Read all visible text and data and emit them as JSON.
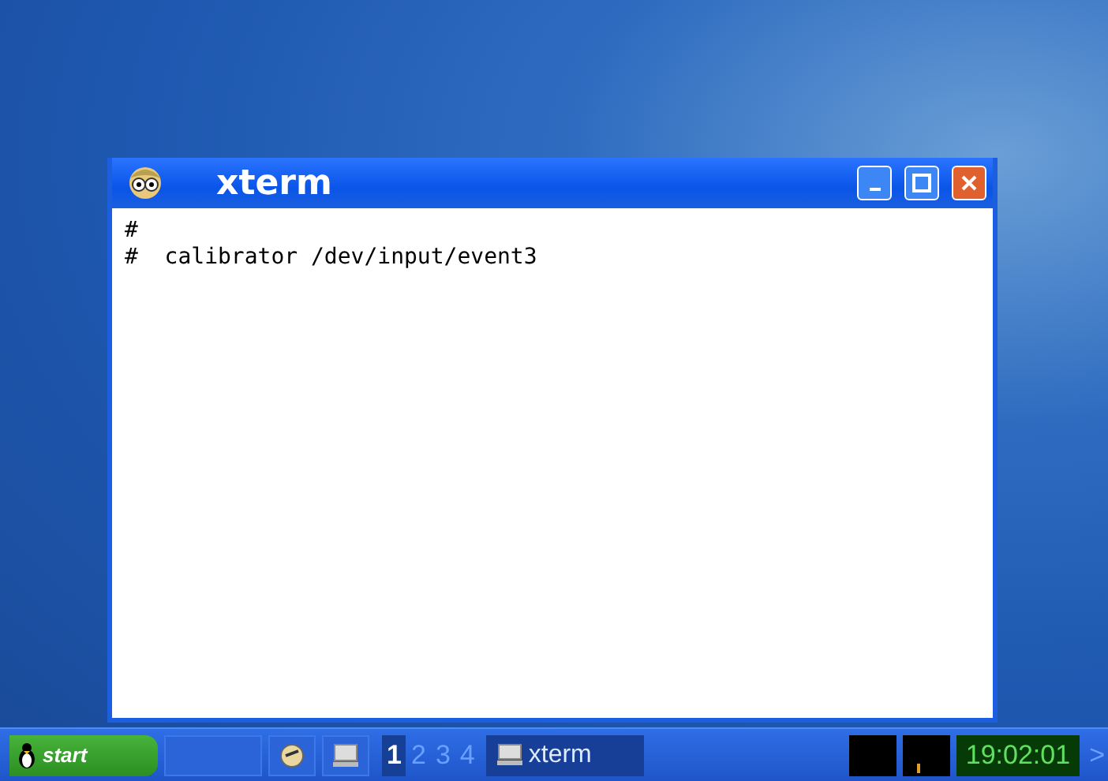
{
  "window": {
    "title": "xterm",
    "lines": [
      "#",
      "#  calibrator /dev/input/event3"
    ]
  },
  "taskbar": {
    "start": "start",
    "workspaces": [
      {
        "label": "1",
        "selected": true
      },
      {
        "label": "2",
        "selected": false
      },
      {
        "label": "3",
        "selected": false
      },
      {
        "label": "4",
        "selected": false
      }
    ],
    "tasks": [
      {
        "label": "xterm",
        "selected": true
      }
    ],
    "clock": "19:02:01",
    "more": ">"
  }
}
